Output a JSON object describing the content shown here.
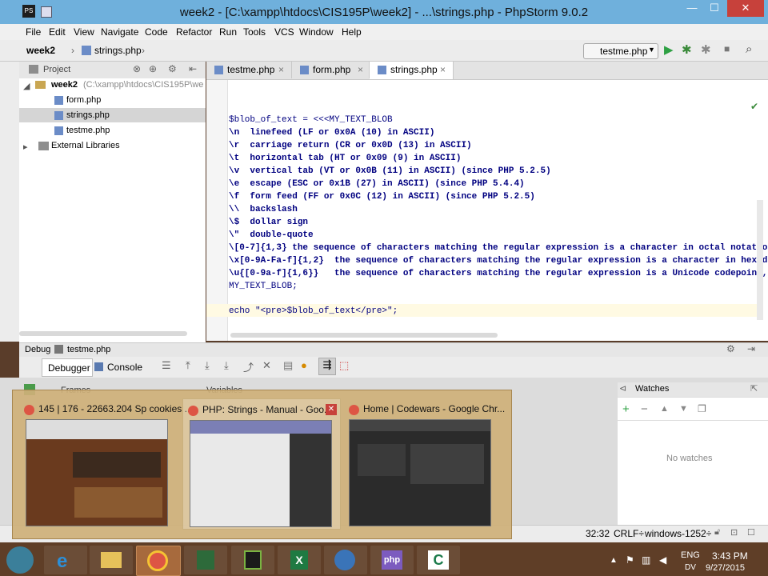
{
  "window": {
    "title": "week2 - [C:\\xampp\\htdocs\\CIS195P\\week2] - ...\\strings.php - PhpStorm 9.0.2",
    "minimize": "—",
    "maximize": "☐",
    "close": "✕",
    "app_icon": "PS"
  },
  "menu": [
    "File",
    "Edit",
    "View",
    "Navigate",
    "Code",
    "Refactor",
    "Run",
    "Tools",
    "VCS",
    "Window",
    "Help"
  ],
  "breadcrumb": {
    "project": "week2",
    "file": "strings.php"
  },
  "run_config": "testme.php",
  "project_panel": {
    "title": "Project",
    "root": "week2",
    "root_path": "(C:\\xampp\\htdocs\\CIS195P\\we",
    "files": [
      "form.php",
      "strings.php",
      "testme.php"
    ],
    "external": "External Libraries"
  },
  "tabs": [
    "testme.php",
    "form.php",
    "strings.php"
  ],
  "code_lines": [
    "$blob_of_text = <<<MY_TEXT_BLOB",
    "\\n  linefeed (LF or 0x0A (10) in ASCII)",
    "\\r  carriage return (CR or 0x0D (13) in ASCII)",
    "\\t  horizontal tab (HT or 0x09 (9) in ASCII)",
    "\\v  vertical tab (VT or 0x0B (11) in ASCII) (since PHP 5.2.5)",
    "\\e  escape (ESC or 0x1B (27) in ASCII) (since PHP 5.4.4)",
    "\\f  form feed (FF or 0x0C (12) in ASCII) (since PHP 5.2.5)",
    "\\\\  backslash",
    "\\$  dollar sign",
    "\\\"  double-quote",
    "\\[0-7]{1,3} the sequence of characters matching the regular expression is a character in octal notatio",
    "\\x[0-9A-Fa-f]{1,2}  the sequence of characters matching the regular expression is a character in hexad",
    "\\u{[0-9a-f]{1,6}}   the sequence of characters matching the regular expression is a Unicode codepoint,",
    "MY_TEXT_BLOB;",
    "",
    "echo \"<pre>$blob_of_text</pre>\";"
  ],
  "debug": {
    "label": "Debug",
    "config": "testme.php",
    "tab_debugger": "Debugger",
    "tab_console": "Console",
    "frames": "Frames",
    "variables": "Variables",
    "watches": "Watches",
    "no_watches": "No watches"
  },
  "status": {
    "position": "32:32",
    "line_sep": "CRLF÷",
    "encoding": "windows-1252÷"
  },
  "thumbnails": [
    {
      "title": "145 | 176 - 22663.204 Sp cookies ..."
    },
    {
      "title": "PHP: Strings - Manual - Goo..."
    },
    {
      "title": "Home | Codewars - Google Chr..."
    }
  ],
  "tray": {
    "lang": "ENG",
    "lang2": "DV",
    "time": "3:43 PM",
    "date": "9/27/2015"
  },
  "colors": {
    "titlebar": "#6fb0dc",
    "close_btn": "#c7413b",
    "thumb_bg": "#ceb078",
    "taskbar": "#5f3e27"
  }
}
